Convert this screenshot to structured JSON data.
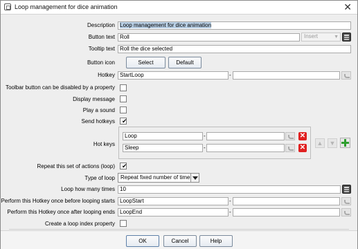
{
  "window": {
    "title": "Loop management for dice animation",
    "close_glyph": "✕"
  },
  "form": {
    "description": {
      "label": "Description",
      "value": "Loop management for dice animation"
    },
    "button_text": {
      "label": "Button text",
      "value": "Roll",
      "insert_combo": "Insert"
    },
    "tooltip_text": {
      "label": "Tooltip text",
      "value": "Roll the dice selected"
    },
    "button_icon": {
      "label": "Button icon",
      "select_label": "Select",
      "default_label": "Default"
    },
    "hotkey": {
      "label": "Hotkey",
      "value": "StartLoop",
      "value2": ""
    },
    "toolbar_disable": {
      "label": "Toolbar button can be disabled by a property",
      "checked": false
    },
    "display_message": {
      "label": "Display message",
      "checked": false
    },
    "play_sound": {
      "label": "Play a sound",
      "checked": false
    },
    "send_hotkeys": {
      "label": "Send hotkeys",
      "checked": true
    },
    "hot_keys": {
      "label": "Hot keys",
      "rows": [
        {
          "key": "Loop",
          "key2": ""
        },
        {
          "key": "Sleep",
          "key2": ""
        }
      ]
    },
    "repeat": {
      "label": "Repeat this set of actions (loop)",
      "checked": true
    },
    "type_of_loop": {
      "label": "Type of loop",
      "value": "Repeat fixed number of times"
    },
    "loop_times": {
      "label": "Loop how many times",
      "value": "10"
    },
    "before_loop": {
      "label": "Perform this Hotkey once before looping starts",
      "value": "LoopStart",
      "value2": ""
    },
    "after_loop": {
      "label": "Perform this Hotkey once after looping ends",
      "value": "LoopEnd",
      "value2": ""
    },
    "loop_index": {
      "label": "Create a loop index property",
      "checked": false
    }
  },
  "footer": {
    "ok": "OK",
    "cancel": "Cancel",
    "help": "Help"
  },
  "dash": "-",
  "check_glyph": "✔",
  "colors": {
    "delete_red": "#e02020",
    "add_green": "#2f9e2f",
    "selection": "#b8cfe5"
  },
  "icons": [
    "app-window-icon",
    "close-icon",
    "calculator-icon",
    "undo-arrow-icon",
    "delete-icon",
    "move-up-icon",
    "move-down-icon",
    "add-icon",
    "dropdown-arrow-icon"
  ]
}
